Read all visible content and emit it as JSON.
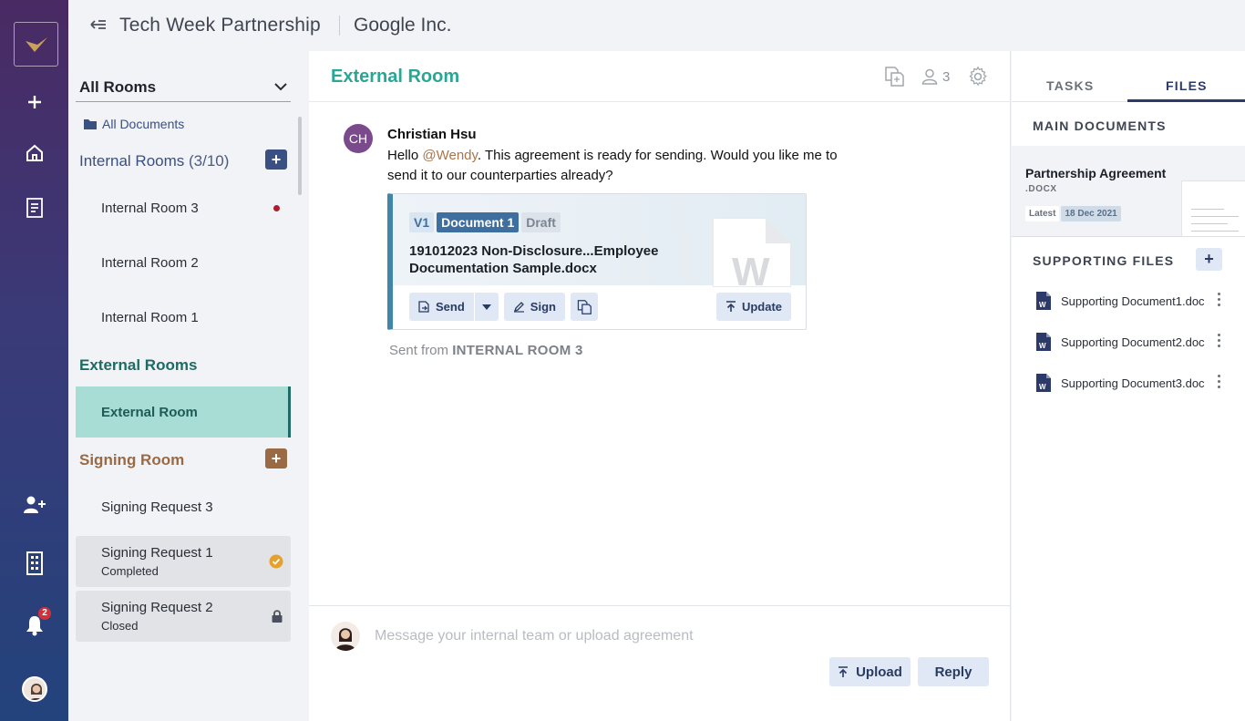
{
  "rail": {
    "notification_count": "2"
  },
  "header": {
    "deal_title": "Tech Week Partnership",
    "company": "Google Inc."
  },
  "sidebar": {
    "room_filter": "All Rooms",
    "all_documents": "All Documents",
    "internal": {
      "title": "Internal Rooms",
      "count": "(3/10)",
      "color": "#3a4f82",
      "rooms": [
        "Internal Room 3",
        "Internal Room 2",
        "Internal Room 1"
      ]
    },
    "external": {
      "title": "External Rooms",
      "color": "#1e6b64",
      "rooms": [
        "External Room"
      ]
    },
    "signing": {
      "title": "Signing Room",
      "color": "#9a6a44",
      "requests": [
        {
          "label": "Signing Request 3",
          "status": ""
        },
        {
          "label": "Signing Request 1",
          "status": "Completed"
        },
        {
          "label": "Signing Request 2",
          "status": "Closed"
        }
      ]
    }
  },
  "room": {
    "title": "External Room",
    "member_count": "3",
    "message": {
      "initials": "CH",
      "author": "Christian Hsu",
      "text_before": "Hello ",
      "mention": "@Wendy",
      "text_after": ". This agreement is ready for sending. Would you like me to send it to our counterparties already?",
      "document": {
        "version": "V1",
        "label": "Document 1",
        "status": "Draft",
        "name": "191012023 Non-Disclosure...Employee Documentation Sample.docx",
        "actions": {
          "send": "Send",
          "sign": "Sign",
          "update": "Update"
        }
      },
      "sent_from_prefix": "Sent from ",
      "sent_from_room": "INTERNAL ROOM 3"
    },
    "composer": {
      "placeholder": "Message your internal team or upload agreement",
      "upload": "Upload",
      "reply": "Reply"
    }
  },
  "panel": {
    "tabs": [
      "TASKS",
      "FILES"
    ],
    "active_tab": "FILES",
    "main_documents_label": "MAIN DOCUMENTS",
    "main_document": {
      "title": "Partnership Agreement",
      "ext": ".DOCX",
      "tag_latest": "Latest",
      "date": "18 Dec 2021"
    },
    "supporting_label": "SUPPORTING FILES",
    "supporting_files": [
      "Supporting Document1.doc",
      "Supporting Document2.doc",
      "Supporting Document3.doc"
    ]
  },
  "colors": {
    "accent_teal": "#2aa695",
    "brand_navy": "#2c3a6a",
    "signing_brown": "#9a6a44",
    "alert_red": "#b21b2f"
  }
}
